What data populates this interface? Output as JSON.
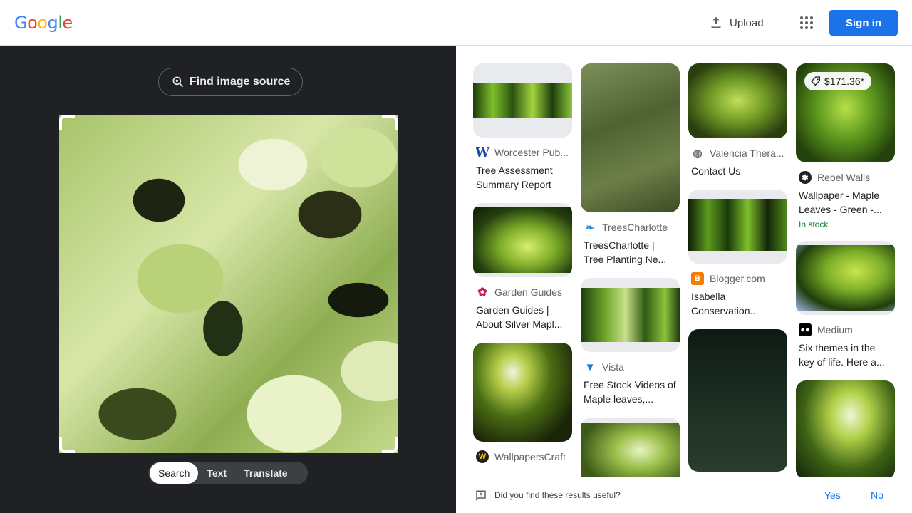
{
  "header": {
    "logo": [
      "G",
      "o",
      "o",
      "g",
      "l",
      "e"
    ],
    "logo_colors": [
      "#4285f4",
      "#ea4335",
      "#fbbc05",
      "#4285f4",
      "#34a853",
      "#ea4335"
    ],
    "upload_label": "Upload",
    "signin_label": "Sign in"
  },
  "left_panel": {
    "find_source_label": "Find image source",
    "tabs": [
      {
        "label": "Search",
        "active": true
      },
      {
        "label": "Text",
        "active": false
      },
      {
        "label": "Translate",
        "active": false
      }
    ]
  },
  "results": [
    {
      "source": "Worcester Pub...",
      "title": "Tree Assessment Summary Report",
      "icon": "worcester-w-icon",
      "icon_color": "#1a4fa0"
    },
    {
      "source": "Garden Guides",
      "title": "Garden Guides | About Silver Mapl...",
      "icon": "flower-icon",
      "icon_color": "#c2185b"
    },
    {
      "source": "WallpapersCraft",
      "title": "",
      "icon": "wallpaperscraft-icon",
      "icon_color": "#202124"
    },
    {
      "source": "TreesCharlotte",
      "title": "TreesCharlotte | Tree Planting Ne...",
      "icon": "bird-icon",
      "icon_color": "#1e88e5"
    },
    {
      "source": "Vista",
      "title": "Free Stock Videos of Maple leaves,...",
      "icon": "vista-v-icon",
      "icon_color": "#1976d2"
    },
    {
      "source": "Valencia Thera...",
      "title": "Contact Us",
      "icon": "globe-icon",
      "icon_color": "#5f6368"
    },
    {
      "source": "Blogger.com",
      "title": "Isabella Conservation...",
      "icon": "blogger-icon",
      "icon_color": "#f57c00"
    },
    {
      "source": "Rebel Walls",
      "title": "Wallpaper - Maple Leaves - Green -...",
      "icon": "rebel-walls-icon",
      "icon_color": "#202124",
      "price": "$171.36*",
      "stock": "In stock"
    },
    {
      "source": "Medium",
      "title": "Six themes in the key of life. Here a...",
      "icon": "medium-icon",
      "icon_color": "#000000"
    }
  ],
  "feedback": {
    "question": "Did you find these results useful?",
    "yes": "Yes",
    "no": "No"
  }
}
